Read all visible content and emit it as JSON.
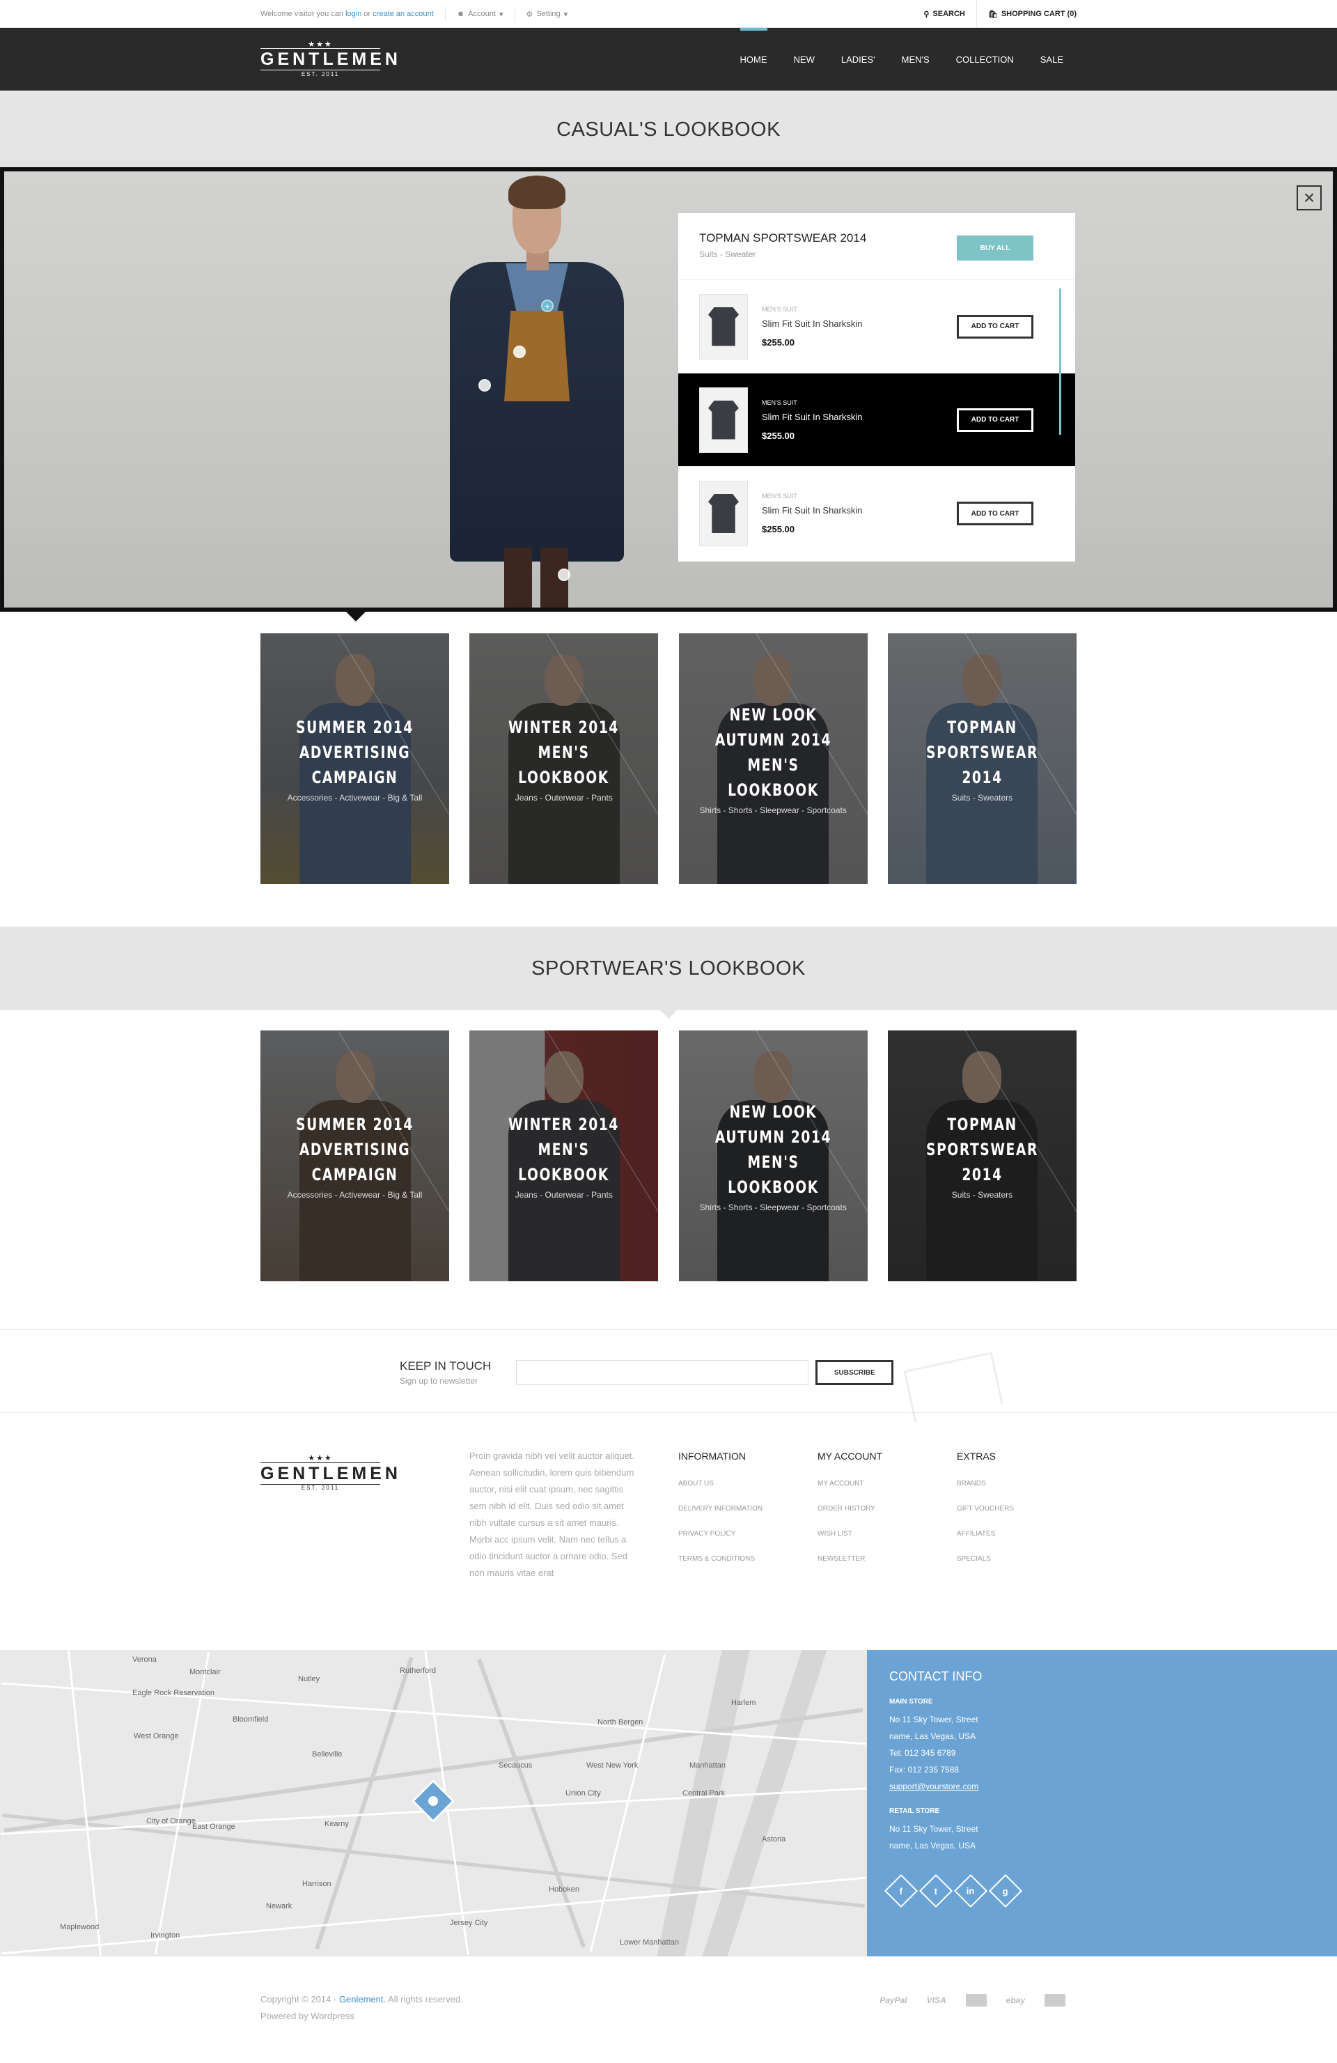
{
  "topbar": {
    "welcome_prefix": "Welcome visitor you can",
    "login": "login",
    "or": "or",
    "create_account": "create an account",
    "account": "Account",
    "setting": "Setting",
    "search": "SEARCH",
    "cart": "SHOPPING CART (0)"
  },
  "header": {
    "logo_name": "GENTLEMEN",
    "logo_est": "EST. 2011",
    "nav": [
      "HOME",
      "NEW",
      "LADIES'",
      "MEN'S",
      "COLLECTION",
      "SALE"
    ]
  },
  "casual": {
    "title": "CASUAL'S LOOKBOOK"
  },
  "hero_panel": {
    "title": "TOPMAN SPORTSWEAR 2014",
    "subtitle": "Suits - Sweater",
    "buy_all": "BUY ALL",
    "products": [
      {
        "category": "MEN'S SUIT",
        "name": "Slim Fit Suit In Sharkskin",
        "price": "$255.00",
        "button": "ADD TO CART"
      },
      {
        "category": "MEN'S SUIT",
        "name": "Slim Fit Suit In Sharkskin",
        "price": "$255.00",
        "button": "ADD TO CART"
      },
      {
        "category": "MEN'S SUIT",
        "name": "Slim Fit Suit In Sharkskin",
        "price": "$255.00",
        "button": "ADD TO CART"
      }
    ]
  },
  "casual_cards": [
    {
      "lines": [
        "SUMMER 2014",
        "ADVERTISING",
        "CAMPAIGN"
      ],
      "tags": "Accessories - Activewear - Big & Tall"
    },
    {
      "lines": [
        "WINTER 2014",
        "MEN'S LOOKBOOK"
      ],
      "tags": "Jeans - Outerwear - Pants"
    },
    {
      "lines": [
        "NEW LOOK",
        "AUTUMN 2014",
        "MEN'S LOOKBOOK"
      ],
      "tags": "Shirts - Shorts - Sleepwear - Sportcoats"
    },
    {
      "lines": [
        "TOPMAN",
        "SPORTSWEAR",
        "2014"
      ],
      "tags": "Suits - Sweaters"
    }
  ],
  "sport": {
    "title": "SPORTWEAR'S LOOKBOOK"
  },
  "sport_cards": [
    {
      "lines": [
        "SUMMER 2014",
        "ADVERTISING",
        "CAMPAIGN"
      ],
      "tags": "Accessories - Activewear - Big & Tall"
    },
    {
      "lines": [
        "WINTER 2014",
        "MEN'S LOOKBOOK"
      ],
      "tags": "Jeans - Outerwear - Pants"
    },
    {
      "lines": [
        "NEW LOOK",
        "AUTUMN 2014",
        "MEN'S LOOKBOOK"
      ],
      "tags": "Shirts - Shorts - Sleepwear - Sportcoats"
    },
    {
      "lines": [
        "TOPMAN",
        "SPORTSWEAR",
        "2014"
      ],
      "tags": "Suits - Sweaters"
    }
  ],
  "newsletter": {
    "title": "KEEP IN TOUCH",
    "subtitle": "Sign up to newsletter",
    "email_placeholder": "",
    "button": "SUBSCRIBE"
  },
  "footer": {
    "about": "Proin gravida nibh vel velit auctor aliquet. Aenean sollicitudin, lorem quis bibendum auctor, nisi elit cuat ipsum, nec sagittis sem nibh id elit. Duis sed odio sit amet nibh vultate cursus a sit amet mauris. Morbi acc ipsum velit. Nam nec tellus a odio tincidunt auctor a ornare odio. Sed non mauris vitae erat",
    "columns": [
      {
        "heading": "INFORMATION",
        "links": [
          "ABOUT US",
          "DELIVERY INFORMATION",
          "PRIVACY POLICY",
          "TERMS & CONDITIONS"
        ]
      },
      {
        "heading": "MY ACCOUNT",
        "links": [
          "MY ACCOUNT",
          "ORDER HISTORY",
          "WISH LIST",
          "NEWSLETTER"
        ]
      },
      {
        "heading": "EXTRAS",
        "links": [
          "BRANDS",
          "GIFT VOUCHERS",
          "AFFILIATES",
          "SPECIALS"
        ]
      }
    ]
  },
  "map": {
    "labels": [
      "Verona",
      "Montclair",
      "Nutley",
      "Rutherford",
      "Eagle Rock Reservation",
      "Bloomfield",
      "West Orange",
      "Belleville",
      "North Bergen",
      "West New York",
      "Union City",
      "Secaucus",
      "Kearny",
      "East Orange",
      "City of Orange",
      "Newark",
      "Harrison",
      "Hoboken",
      "Jersey City",
      "Irvington",
      "Maplewood",
      "Manhattan",
      "Harlem",
      "Central Park",
      "Astoria",
      "Lower Manhattan"
    ]
  },
  "contact": {
    "title": "CONTACT INFO",
    "main_store": "MAIN STORE",
    "main_addr1": "No 11 Sky Tower, Street",
    "main_addr2": "name, Las Vegas, USA",
    "tel": "Tel: 012 345 6789",
    "fax": "Fax: 012 235 7588",
    "email": "support@yourstore.com",
    "retail_store": "RETAIL STORE",
    "retail_addr1": "No 11 Sky Tower, Street",
    "retail_addr2": "name, Las Vegas, USA",
    "socials": [
      "f",
      "t",
      "in",
      "g"
    ]
  },
  "bottom": {
    "copy_prefix": "Copyright © 2014 -",
    "brand": "Genlement.",
    "copy_suffix": "All rights reserved.",
    "powered": "Powered by Wordpress",
    "payments": [
      "PayPal",
      "VISA",
      "ebay"
    ]
  }
}
